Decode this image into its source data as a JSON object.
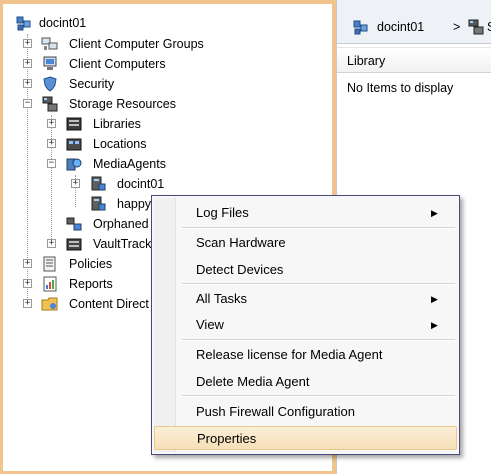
{
  "tree": {
    "root_label": "docint01",
    "items": [
      {
        "label": "Client Computer Groups"
      },
      {
        "label": "Client Computers"
      },
      {
        "label": "Security"
      },
      {
        "label": "Storage Resources"
      },
      {
        "label": "Libraries"
      },
      {
        "label": "Locations"
      },
      {
        "label": "MediaAgents"
      },
      {
        "label": "docint01"
      },
      {
        "label": "happy"
      },
      {
        "label": "Orphaned"
      },
      {
        "label": "VaultTrack"
      },
      {
        "label": "Policies"
      },
      {
        "label": "Reports"
      },
      {
        "label": "Content Direct"
      }
    ]
  },
  "breadcrumb": {
    "item1": "docint01",
    "separator": ">",
    "item2": "S"
  },
  "list": {
    "column_header": "Library",
    "empty_message": "No Items to display"
  },
  "context_menu": {
    "items": [
      {
        "label": "Log Files",
        "submenu": true
      },
      {
        "label": "Scan Hardware"
      },
      {
        "label": "Detect Devices"
      },
      {
        "label": "All Tasks",
        "submenu": true
      },
      {
        "label": "View",
        "submenu": true
      },
      {
        "label": "Release license for Media Agent"
      },
      {
        "label": "Delete Media Agent"
      },
      {
        "label": "Push Firewall Configuration"
      },
      {
        "label": "Properties",
        "highlighted": true
      }
    ],
    "submenu_arrow": "▶"
  },
  "colors": {
    "pane_border": "#f0c48c",
    "menu_highlight": "#f6dfb6",
    "menu_border": "#4a4a7a"
  }
}
